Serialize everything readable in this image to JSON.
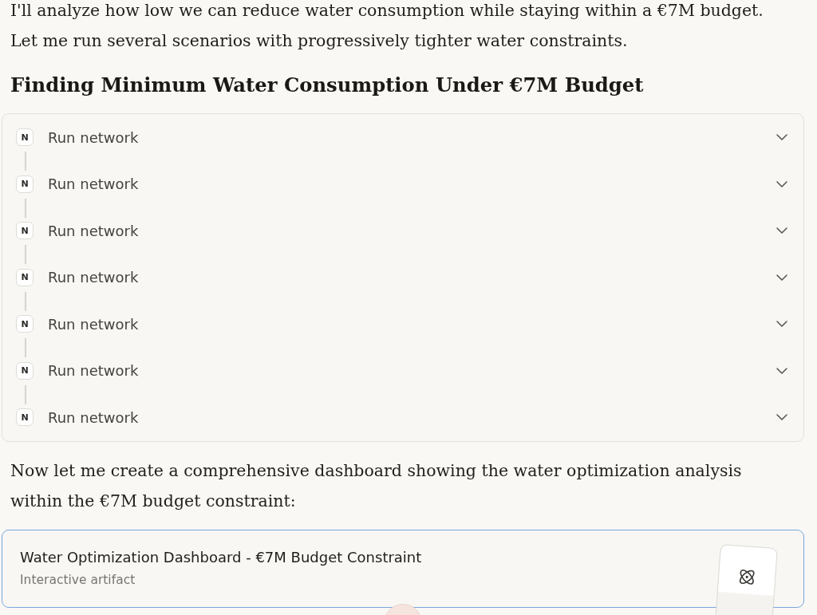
{
  "message": {
    "intro": "I'll analyze how low we can reduce water consumption while staying within a €7M budget. Let me run several scenarios with progressively tighter water constraints.",
    "heading": "Finding Minimum Water Consumption Under €7M Budget",
    "tool_calls": [
      {
        "badge": "N",
        "label": "Run network",
        "expanded": false
      },
      {
        "badge": "N",
        "label": "Run network",
        "expanded": false
      },
      {
        "badge": "N",
        "label": "Run network",
        "expanded": false
      },
      {
        "badge": "N",
        "label": "Run network",
        "expanded": false
      },
      {
        "badge": "N",
        "label": "Run network",
        "expanded": false
      },
      {
        "badge": "N",
        "label": "Run network",
        "expanded": false
      },
      {
        "badge": "N",
        "label": "Run network",
        "expanded": false
      }
    ],
    "outro": "Now let me create a comprehensive dashboard showing the water optimization analysis within the €7M budget constraint:",
    "artifact": {
      "title": "Water Optimization Dashboard - €7M Budget Constraint",
      "subtitle": "Interactive artifact"
    }
  }
}
